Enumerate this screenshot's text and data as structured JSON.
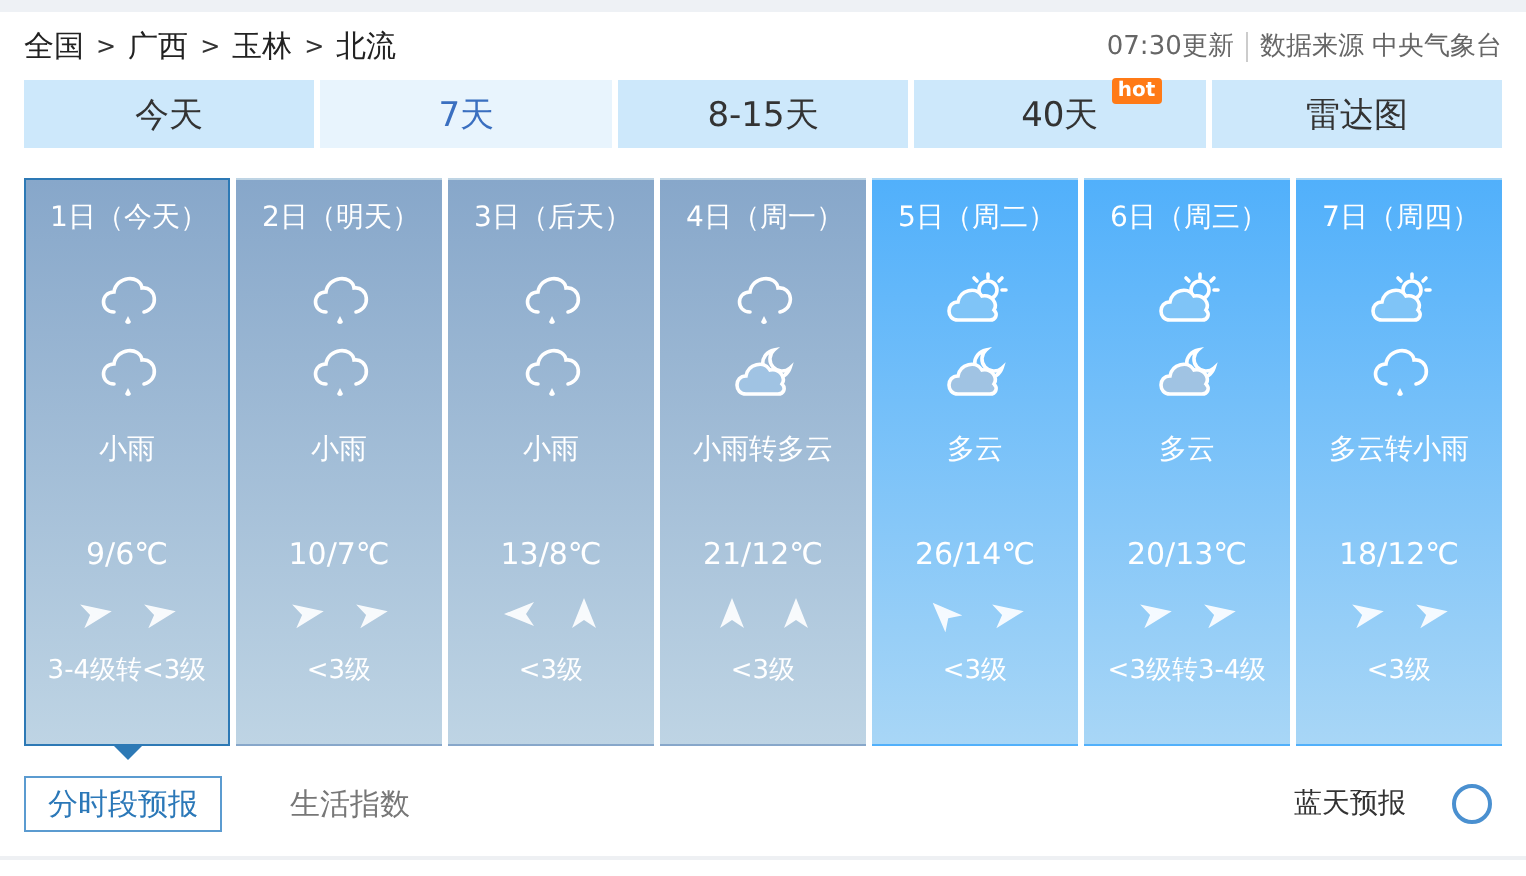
{
  "breadcrumb": [
    {
      "label": "全国"
    },
    {
      "label": "广西"
    },
    {
      "label": "玉林"
    },
    {
      "label": "北流"
    }
  ],
  "breadcrumb_separator": ">",
  "update": {
    "time": "07:30更新",
    "source": "数据来源 中央气象台"
  },
  "tabs": [
    {
      "label": "今天",
      "selected": false
    },
    {
      "label": "7天",
      "selected": true
    },
    {
      "label": "8-15天",
      "selected": false
    },
    {
      "label": "40天",
      "selected": false,
      "badge": "hot"
    },
    {
      "label": "雷达图",
      "selected": false
    }
  ],
  "days": [
    {
      "date": "1日（今天）",
      "selected": true,
      "kind": "overcast",
      "icons": [
        {
          "kind": "rain"
        },
        {
          "kind": "rain"
        }
      ],
      "weather": "小雨",
      "temp": "9/6℃",
      "winds": [
        {
          "kind": "east"
        },
        {
          "kind": "east"
        }
      ],
      "wind_level": "3-4级转<3级"
    },
    {
      "date": "2日（明天）",
      "selected": false,
      "kind": "overcast",
      "icons": [
        {
          "kind": "rain"
        },
        {
          "kind": "rain"
        }
      ],
      "weather": "小雨",
      "temp": "10/7℃",
      "winds": [
        {
          "kind": "east"
        },
        {
          "kind": "east"
        }
      ],
      "wind_level": "<3级"
    },
    {
      "date": "3日（后天）",
      "selected": false,
      "kind": "overcast",
      "icons": [
        {
          "kind": "rain"
        },
        {
          "kind": "rain"
        }
      ],
      "weather": "小雨",
      "temp": "13/8℃",
      "winds": [
        {
          "kind": "west"
        },
        {
          "kind": "north"
        }
      ],
      "wind_level": "<3级"
    },
    {
      "date": "4日（周一）",
      "selected": false,
      "kind": "overcast",
      "icons": [
        {
          "kind": "rain"
        },
        {
          "kind": "moon"
        }
      ],
      "weather": "小雨转多云",
      "temp": "21/12℃",
      "winds": [
        {
          "kind": "north"
        },
        {
          "kind": "north"
        }
      ],
      "wind_level": "<3级"
    },
    {
      "date": "5日（周二）",
      "selected": false,
      "kind": "fair",
      "icons": [
        {
          "kind": "sun"
        },
        {
          "kind": "moon"
        }
      ],
      "weather": "多云",
      "temp": "26/14℃",
      "winds": [
        {
          "kind": "northwest"
        },
        {
          "kind": "east"
        }
      ],
      "wind_level": "<3级"
    },
    {
      "date": "6日（周三）",
      "selected": false,
      "kind": "fair",
      "icons": [
        {
          "kind": "sun"
        },
        {
          "kind": "moon"
        }
      ],
      "weather": "多云",
      "temp": "20/13℃",
      "winds": [
        {
          "kind": "east"
        },
        {
          "kind": "east"
        }
      ],
      "wind_level": "<3级转3-4级"
    },
    {
      "date": "7日（周四）",
      "selected": false,
      "kind": "fair",
      "icons": [
        {
          "kind": "sun"
        },
        {
          "kind": "rain"
        }
      ],
      "weather": "多云转小雨",
      "temp": "18/12℃",
      "winds": [
        {
          "kind": "east"
        },
        {
          "kind": "east"
        }
      ],
      "wind_level": "<3级"
    }
  ],
  "bottom_tabs": [
    {
      "label": "分时段预报",
      "selected": true
    },
    {
      "label": "生活指数",
      "selected": false
    }
  ],
  "bottom_link": "蓝天预报"
}
